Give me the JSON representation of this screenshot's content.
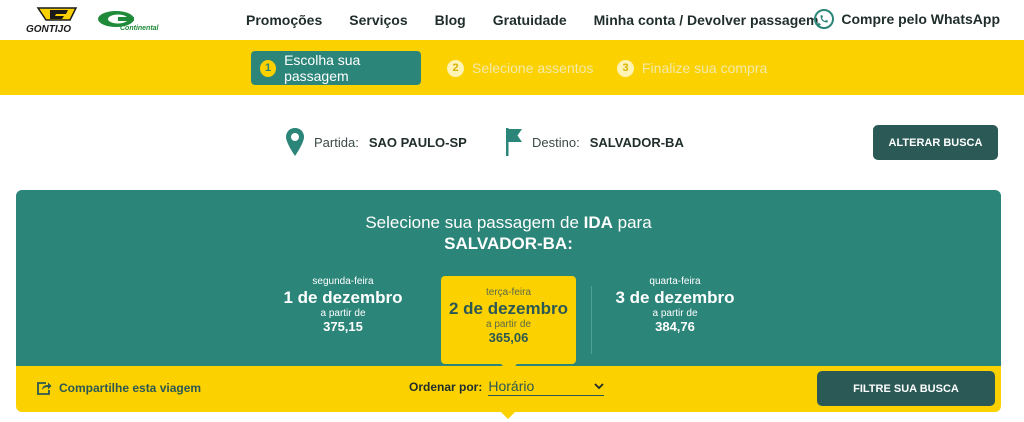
{
  "header": {
    "logo_gontijo": "GONTIJO",
    "logo_continental": "Continental",
    "nav": [
      {
        "label": "Promoções",
        "name": "nav-promocoes"
      },
      {
        "label": "Serviços",
        "name": "nav-servicos"
      },
      {
        "label": "Blog",
        "name": "nav-blog"
      },
      {
        "label": "Gratuidade",
        "name": "nav-gratuidade"
      },
      {
        "label": "Minha conta / Devolver passagem",
        "name": "nav-minha-conta"
      }
    ],
    "whatsapp_label": "Compre pelo WhatsApp",
    "whatsapp_icon": "whatsapp-icon"
  },
  "steps": [
    {
      "number": "1",
      "label": "Escolha sua passagem",
      "active": true
    },
    {
      "number": "2",
      "label": "Selecione assentos",
      "active": false
    },
    {
      "number": "3",
      "label": "Finalize sua compra",
      "active": false
    }
  ],
  "route": {
    "origin_label": "Partida:",
    "origin_value": "SAO PAULO-SP",
    "origin_icon": "map-pin-icon",
    "destination_label": "Destino:",
    "destination_value": "SALVADOR-BA",
    "destination_icon": "flag-icon",
    "alter_button": "ALTERAR BUSCA"
  },
  "panel": {
    "title_prefix": "Selecione sua passagem de ",
    "title_strong": "IDA",
    "title_suffix": " para",
    "title_destination": "SALVADOR-BA:",
    "days": [
      {
        "weekday": "segunda-feira",
        "date": "1 de dezembro",
        "from_label": "a partir de",
        "price": "375,15",
        "selected": false
      },
      {
        "weekday": "terça-feira",
        "date": "2 de dezembro",
        "from_label": "a partir de",
        "price": "365,06",
        "selected": true
      },
      {
        "weekday": "quarta-feira",
        "date": "3 de dezembro",
        "from_label": "a partir de",
        "price": "384,76",
        "selected": false
      }
    ]
  },
  "filterbar": {
    "share_label": "Compartilhe esta viagem",
    "share_icon": "share-icon",
    "order_label": "Ordenar por:",
    "order_value": "Horário",
    "filter_button": "FILTRE SUA BUSCA"
  },
  "colors": {
    "yellow": "#fcd100",
    "teal": "#2c8579",
    "dark_teal": "#2b5a56",
    "green_brand": "#1f8a3a"
  }
}
